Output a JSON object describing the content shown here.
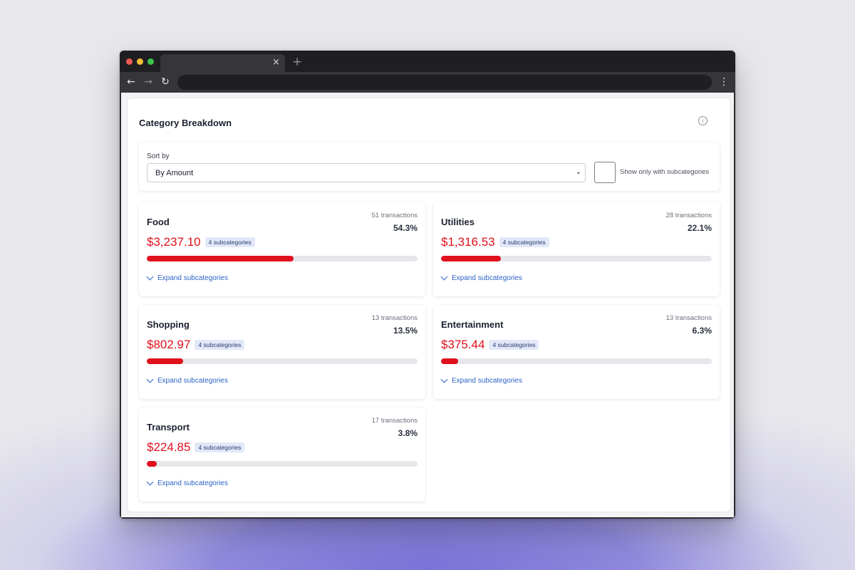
{
  "browser": {
    "tab_close": "×",
    "new_tab": "+",
    "back": "←",
    "forward": "→",
    "reload": "↻",
    "menu": "⋮"
  },
  "panel": {
    "title": "Category Breakdown",
    "info_icon": "info-icon"
  },
  "sort": {
    "label": "Sort by",
    "selected": "By Amount",
    "chevron": "⌄",
    "checkbox_label": "Show only with subcategories",
    "checked": false
  },
  "expand_label": "Expand subcategories",
  "accent_color": "#e0101c",
  "link_color": "#2d63c8",
  "categories": [
    {
      "name": "Food",
      "transactions": "51 transactions",
      "percent": "54.3%",
      "share": 0.543,
      "amount": "$3,237.10",
      "badge": "4 subcategories"
    },
    {
      "name": "Utilities",
      "transactions": "28 transactions",
      "percent": "22.1%",
      "share": 0.221,
      "amount": "$1,316.53",
      "badge": "4 subcategories"
    },
    {
      "name": "Shopping",
      "transactions": "13 transactions",
      "percent": "13.5%",
      "share": 0.135,
      "amount": "$802.97",
      "badge": "4 subcategories"
    },
    {
      "name": "Entertainment",
      "transactions": "13 transactions",
      "percent": "6.3%",
      "share": 0.063,
      "amount": "$375.44",
      "badge": "4 subcategories"
    },
    {
      "name": "Transport",
      "transactions": "17 transactions",
      "percent": "3.8%",
      "share": 0.038,
      "amount": "$224.85",
      "badge": "4 subcategories"
    }
  ]
}
